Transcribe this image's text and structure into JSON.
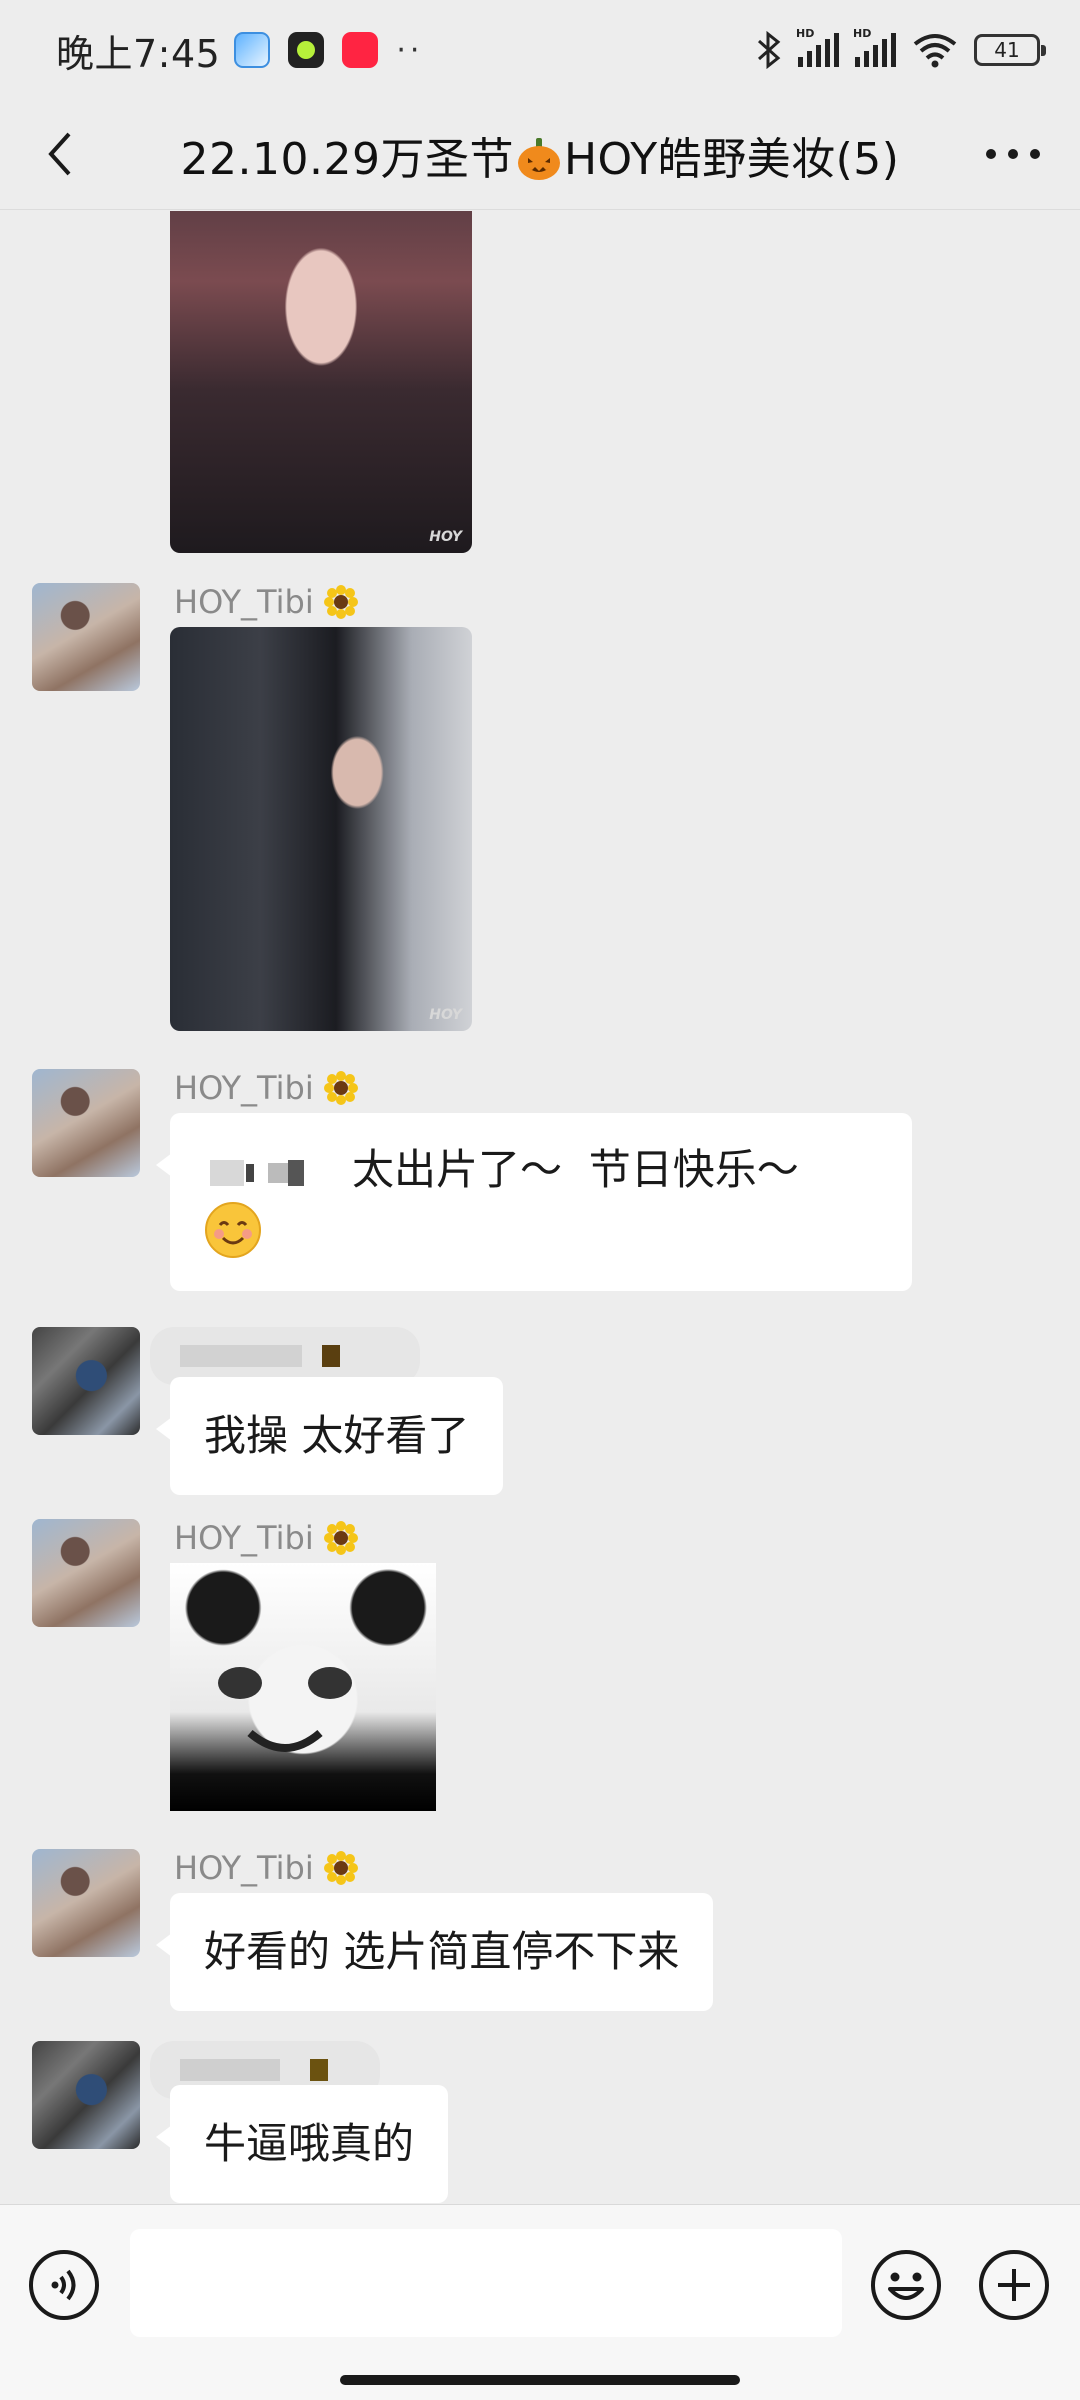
{
  "status_bar": {
    "time": "晚上7:45",
    "overflow_dots": "··",
    "signal_label_1": "HD",
    "signal_label_2": "HD",
    "battery": "41"
  },
  "header": {
    "title_prefix": "22.10.29万圣节",
    "title_suffix": "HOY皓野美妆(5)"
  },
  "messages": [
    {
      "sender": "HOY_Tibi"
    },
    {
      "sender": "HOY_Tibi",
      "text_a": "太出片了～",
      "text_b": "节日快乐～"
    },
    {
      "text": "我操 太好看了"
    },
    {
      "sender": "HOY_Tibi"
    },
    {
      "sender": "HOY_Tibi",
      "text": "好看的 选片简直停不下来"
    },
    {
      "text": "牛逼哦真的"
    }
  ],
  "photo_watermark": "HOY",
  "input": {
    "value": "",
    "placeholder": ""
  },
  "colors": {
    "background": "#ededed",
    "bubble": "#ffffff",
    "sender": "#8a8a8a",
    "input_bar": "#f7f7f7"
  }
}
